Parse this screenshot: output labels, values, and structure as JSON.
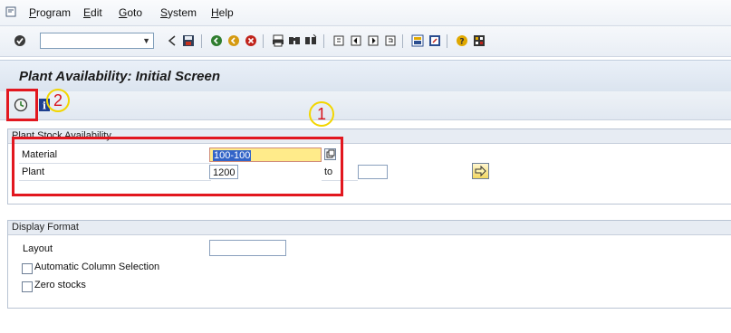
{
  "menu": {
    "items": [
      "Program",
      "Edit",
      "Goto",
      "System",
      "Help"
    ]
  },
  "toolbar": {
    "command_value": ""
  },
  "title": "Plant Availability: Initial Screen",
  "groups": {
    "plant_stock": {
      "title": "Plant Stock Availability",
      "material_label": "Material",
      "material_value": "100-100",
      "plant_label": "Plant",
      "plant_value": "1200",
      "to_label": "to",
      "plant_to_value": ""
    },
    "display_format": {
      "title": "Display Format",
      "layout_label": "Layout",
      "layout_value": "",
      "auto_col_label": "Automatic Column Selection",
      "zero_stocks_label": "Zero stocks"
    }
  },
  "annotations": {
    "one": "1",
    "two": "2"
  },
  "colors": {
    "highlight_field": "#ffeb8a",
    "annotation_red": "#e2171f",
    "annotation_yellow": "#f2d600"
  }
}
